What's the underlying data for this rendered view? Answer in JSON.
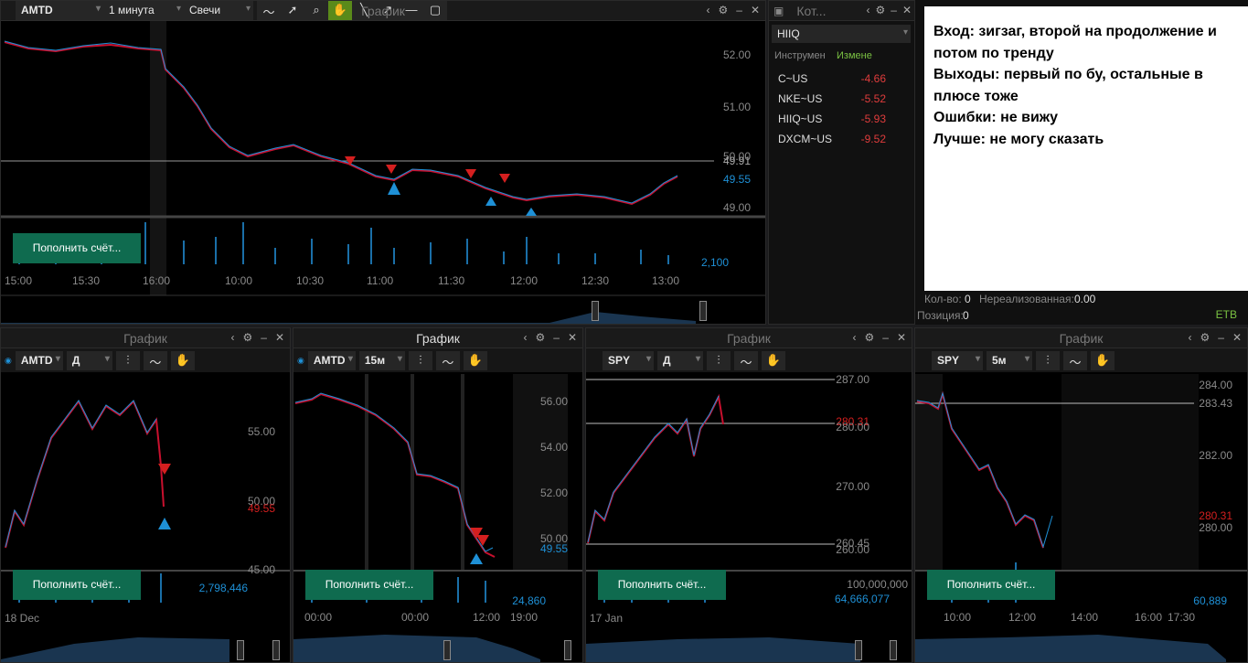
{
  "top_chart": {
    "symbol": "AMTD",
    "interval": "1 минута",
    "type": "Свечи",
    "title": "График",
    "y_labels": [
      "52.00",
      "51.00",
      "50.00",
      "49.91",
      "49.55",
      "49.00"
    ],
    "volume_label": "2,100",
    "x_labels": [
      "15:00",
      "15:30",
      "16:00",
      "10:00",
      "10:30",
      "11:00",
      "11:30",
      "12:00",
      "12:30",
      "13:00"
    ],
    "deposit_button": "Пополнить счёт..."
  },
  "quotes": {
    "title": "Кот...",
    "input": "HIIQ",
    "col_instrument": "Инструмен",
    "col_change": "Измене",
    "rows": [
      {
        "sym": "C~US",
        "chg": "-4.66"
      },
      {
        "sym": "NKE~US",
        "chg": "-5.52"
      },
      {
        "sym": "HIIQ~US",
        "chg": "-5.93"
      },
      {
        "sym": "DXCM~US",
        "chg": "-9.52"
      }
    ]
  },
  "note": {
    "line1": "Вход: зигзаг, второй на продолжение и потом по тренду",
    "line2": "Выходы: первый по бу, остальные в плюсе тоже",
    "line3": "Ошибки: не вижу",
    "line4": "Лучше: не могу сказать"
  },
  "position_bar": {
    "qty_label": "Кол-во:",
    "qty": "0",
    "unreal_label": "Нереализованная:",
    "unreal": "0.00",
    "pos_label": "Позиция:",
    "pos": "0",
    "exchange": "ETB"
  },
  "charts": [
    {
      "symbol": "AMTD",
      "interval": "Д",
      "title": "График",
      "y": [
        "55.00",
        "50.00",
        "49.55",
        "45.00"
      ],
      "vol": "2,798,446",
      "x": [
        "18 Dec"
      ],
      "deposit": "Пополнить счёт..."
    },
    {
      "symbol": "AMTD",
      "interval": "15м",
      "title": "График",
      "y": [
        "56.00",
        "54.00",
        "52.00",
        "50.00",
        "49.55"
      ],
      "vol": "24,860",
      "x": [
        "00:00",
        "00:00",
        "12:00",
        "19:00"
      ],
      "deposit": "Пополнить счёт..."
    },
    {
      "symbol": "SPY",
      "interval": "Д",
      "title": "График",
      "y": [
        "287.00",
        "280.31",
        "280.00",
        "270.00",
        "260.45",
        "260.00"
      ],
      "vol": "100,000,000",
      "vol2": "64,666,077",
      "x": [
        "17 Jan"
      ],
      "deposit": "Пополнить счёт..."
    },
    {
      "symbol": "SPY",
      "interval": "5м",
      "title": "График",
      "y": [
        "284.00",
        "283.43",
        "282.00",
        "280.31",
        "280.00"
      ],
      "vol": "60,889",
      "x": [
        "10:00",
        "12:00",
        "14:00",
        "16:00",
        "17:30"
      ],
      "deposit": "Пополнить счёт..."
    }
  ]
}
